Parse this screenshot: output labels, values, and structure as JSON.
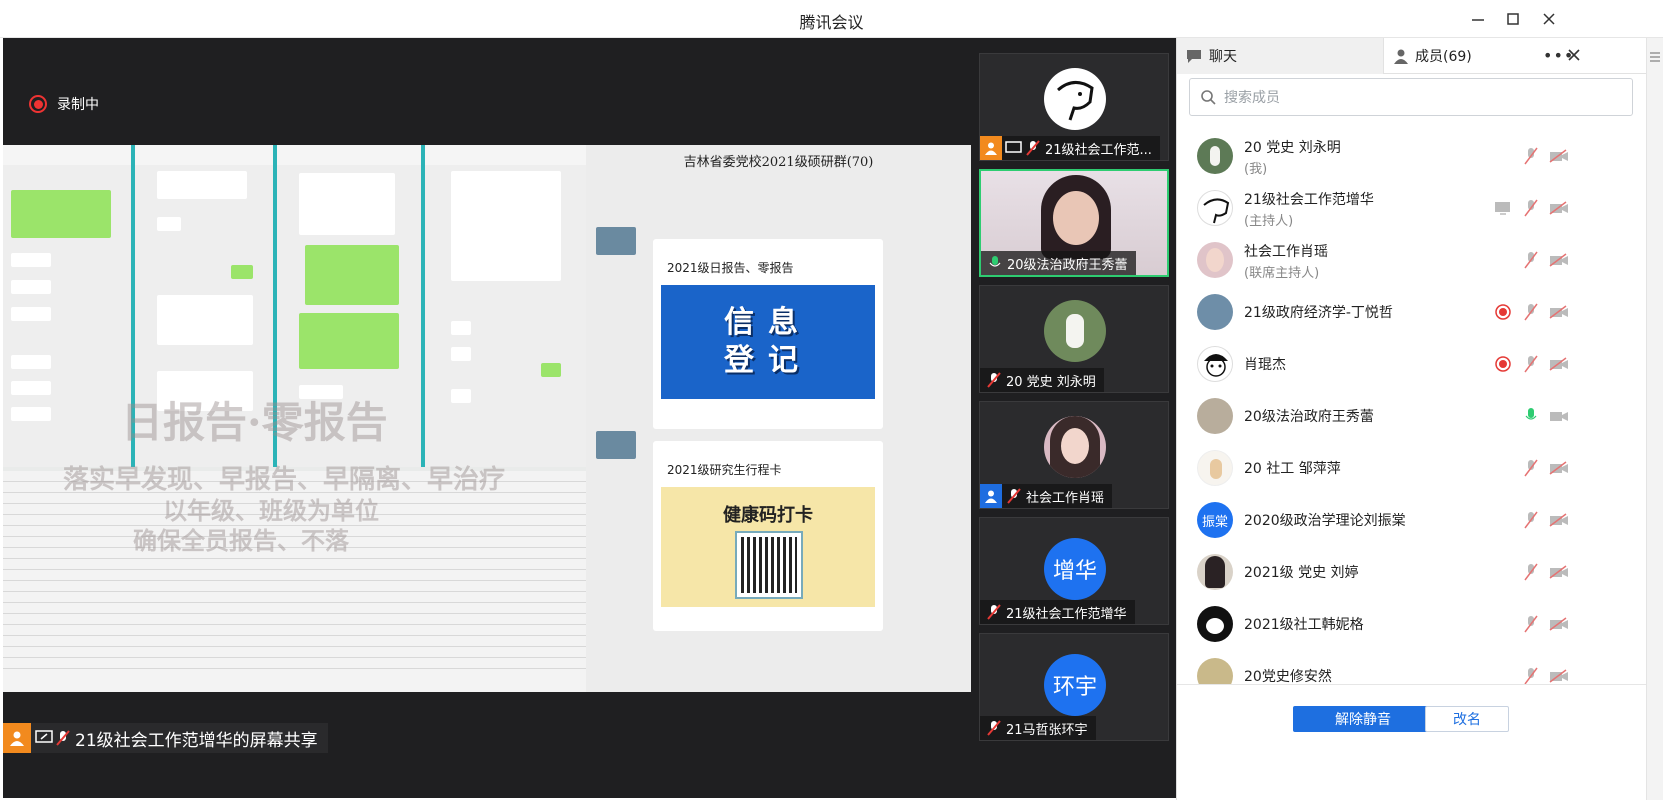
{
  "window": {
    "title": "腾讯会议"
  },
  "recording": {
    "label": "录制中"
  },
  "share": {
    "label": "21级社会工作范增华的屏幕共享",
    "chat_title": "吉林省委党校2021级硕研群(70)",
    "card1_title": "2021级日报告、零报告",
    "card1_poster_line1": "信息",
    "card1_poster_line2": "登记",
    "card2_title": "2021级研究生行程卡",
    "card2_poster": "健康码打卡",
    "watermark_1": "日报告·零报告",
    "watermark_2": "落实早发现、早报告、早隔离、早治疗",
    "watermark_3": "以年级、班级为单位",
    "watermark_4": "确保全员报告、不落"
  },
  "video_tiles": [
    {
      "name": "21级社会工作范...",
      "avatar": "dog-sketch-avatar",
      "muted": true
    },
    {
      "name": "20级法治政府王秀蕾",
      "avatar": "woman-video",
      "muted": false
    },
    {
      "name": "20 党史 刘永明",
      "avatar": "photo-avatar",
      "muted": true
    },
    {
      "name": "社会工作肖瑶",
      "avatar": "photo-avatar",
      "muted": true
    },
    {
      "name": "21级社会工作范增华",
      "avatar_text": "增华",
      "muted": true
    },
    {
      "name": "21马哲张环宇",
      "avatar_text": "环宇",
      "muted": true
    }
  ],
  "panel": {
    "tab_chat": "聊天",
    "tab_members": "成员(69)",
    "search_placeholder": "搜索成员",
    "unmute_button": "解除静音",
    "rename_button": "改名"
  },
  "members": [
    {
      "name": "20 党史 刘永明",
      "role": "(我)",
      "recording": false,
      "mic": "muted"
    },
    {
      "name": "21级社会工作范增华",
      "role": "(主持人)",
      "recording": false,
      "mic": "muted",
      "sharing": true
    },
    {
      "name": "社会工作肖瑶",
      "role": "(联席主持人)",
      "recording": false,
      "mic": "muted"
    },
    {
      "name": "21级政府经济学-丁悦哲",
      "role": "",
      "recording": true,
      "mic": "muted"
    },
    {
      "name": "肖琨杰",
      "role": "",
      "recording": true,
      "mic": "muted"
    },
    {
      "name": "20级法治政府王秀蕾",
      "role": "",
      "recording": false,
      "mic": "active"
    },
    {
      "name": "20  社工 邹萍萍",
      "role": "",
      "recording": false,
      "mic": "muted"
    },
    {
      "name": "2020级政治学理论刘振棠",
      "role": "",
      "recording": false,
      "mic": "muted",
      "avatar_text": "振棠"
    },
    {
      "name": "2021级 党史 刘婷",
      "role": "",
      "recording": false,
      "mic": "muted"
    },
    {
      "name": "2021级社工韩妮格",
      "role": "",
      "recording": false,
      "mic": "muted"
    },
    {
      "name": "20党史修安然",
      "role": "",
      "recording": false,
      "mic": "muted"
    }
  ],
  "colors": {
    "accent": "#1e6fe0",
    "record_red": "#e53935",
    "mic_green": "#2ecc71",
    "share_orange": "#f28a1e"
  }
}
